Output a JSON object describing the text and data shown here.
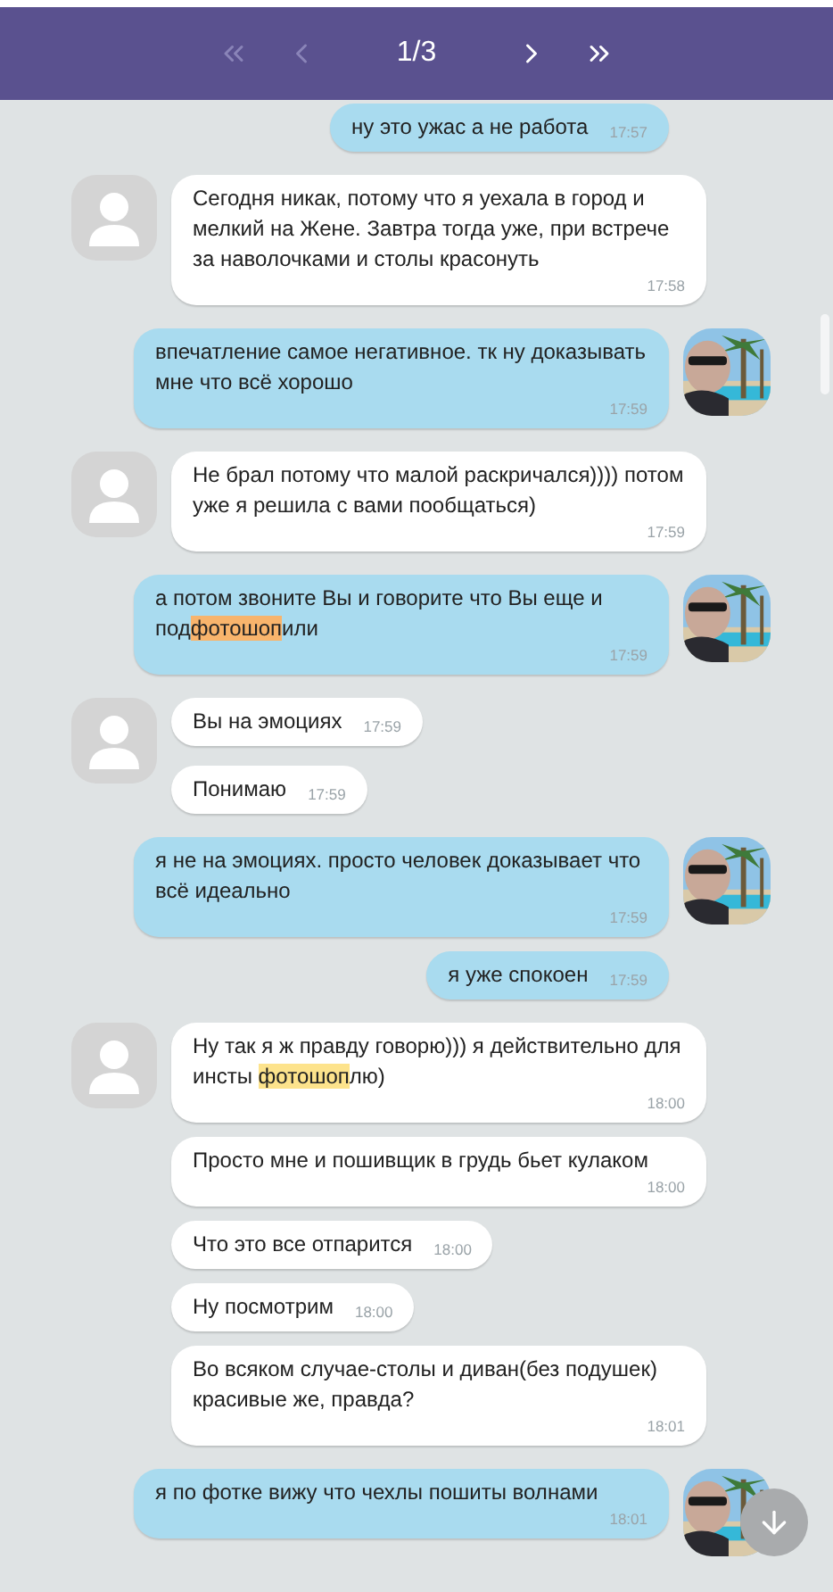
{
  "header": {
    "pager": "1/3",
    "nav": [
      {
        "kind": "first",
        "disabled": true
      },
      {
        "kind": "prev",
        "disabled": true
      },
      {
        "kind": "next",
        "disabled": false
      },
      {
        "kind": "last",
        "disabled": false
      }
    ]
  },
  "messages": [
    {
      "kind": "out",
      "avatar": false,
      "parts": [
        {
          "text": "ну это ужас а не работа"
        }
      ],
      "time": "17:57"
    },
    {
      "kind": "in",
      "avatar": true,
      "parts": [
        {
          "text": "Сегодня никак, потому что я уехала в город и мелкий на Жене. Завтра тогда уже, при встрече за наволочками и столы красонуть"
        }
      ],
      "time": "17:58"
    },
    {
      "kind": "out",
      "avatar": true,
      "parts": [
        {
          "text": "впечатление самое негативное. тк ну доказывать мне что всё хорошо"
        }
      ],
      "time": "17:59"
    },
    {
      "kind": "in",
      "avatar": true,
      "parts": [
        {
          "text": "Не брал потому что малой раскричался)))) потом уже я решила с вами пообщаться)"
        }
      ],
      "time": "17:59"
    },
    {
      "kind": "out",
      "avatar": true,
      "parts": [
        {
          "text": "а потом звоните Вы и говорите что Вы еще и под"
        },
        {
          "text": "фотошоп",
          "color": "#f8b46c"
        },
        {
          "text": "или"
        }
      ],
      "time": "17:59"
    },
    {
      "kind": "in",
      "avatar": true,
      "parts": [
        {
          "text": "Вы на эмоциях"
        }
      ],
      "time": "17:59"
    },
    {
      "kind": "in",
      "avatar": false,
      "parts": [
        {
          "text": "Понимаю"
        }
      ],
      "time": "17:59"
    },
    {
      "kind": "out",
      "avatar": true,
      "parts": [
        {
          "text": "я не на эмоциях. просто человек доказывает что всё идеально"
        }
      ],
      "time": "17:59"
    },
    {
      "kind": "out",
      "avatar": false,
      "parts": [
        {
          "text": "я уже спокоен"
        }
      ],
      "time": "17:59"
    },
    {
      "kind": "in",
      "avatar": true,
      "parts": [
        {
          "text": "Ну так я ж правду говорю))) я действительно для инсты "
        },
        {
          "text": "фотошоп",
          "color": "#fde38c"
        },
        {
          "text": "лю)"
        }
      ],
      "time": "18:00"
    },
    {
      "kind": "in",
      "avatar": false,
      "parts": [
        {
          "text": "Просто мне и пошивщик в грудь бьет кулаком"
        }
      ],
      "time": "18:00"
    },
    {
      "kind": "in",
      "avatar": false,
      "parts": [
        {
          "text": "Что это все отпарится"
        }
      ],
      "time": "18:00"
    },
    {
      "kind": "in",
      "avatar": false,
      "parts": [
        {
          "text": "Ну посмотрим"
        }
      ],
      "time": "18:00"
    },
    {
      "kind": "in",
      "avatar": false,
      "parts": [
        {
          "text": "Во всяком случае-столы и диван(без подушек) красивые же, правда?"
        }
      ],
      "time": "18:01"
    },
    {
      "kind": "out",
      "avatar": true,
      "parts": [
        {
          "text": "я по фотке вижу что чехлы пошиты волнами"
        }
      ],
      "time": "18:01"
    }
  ]
}
